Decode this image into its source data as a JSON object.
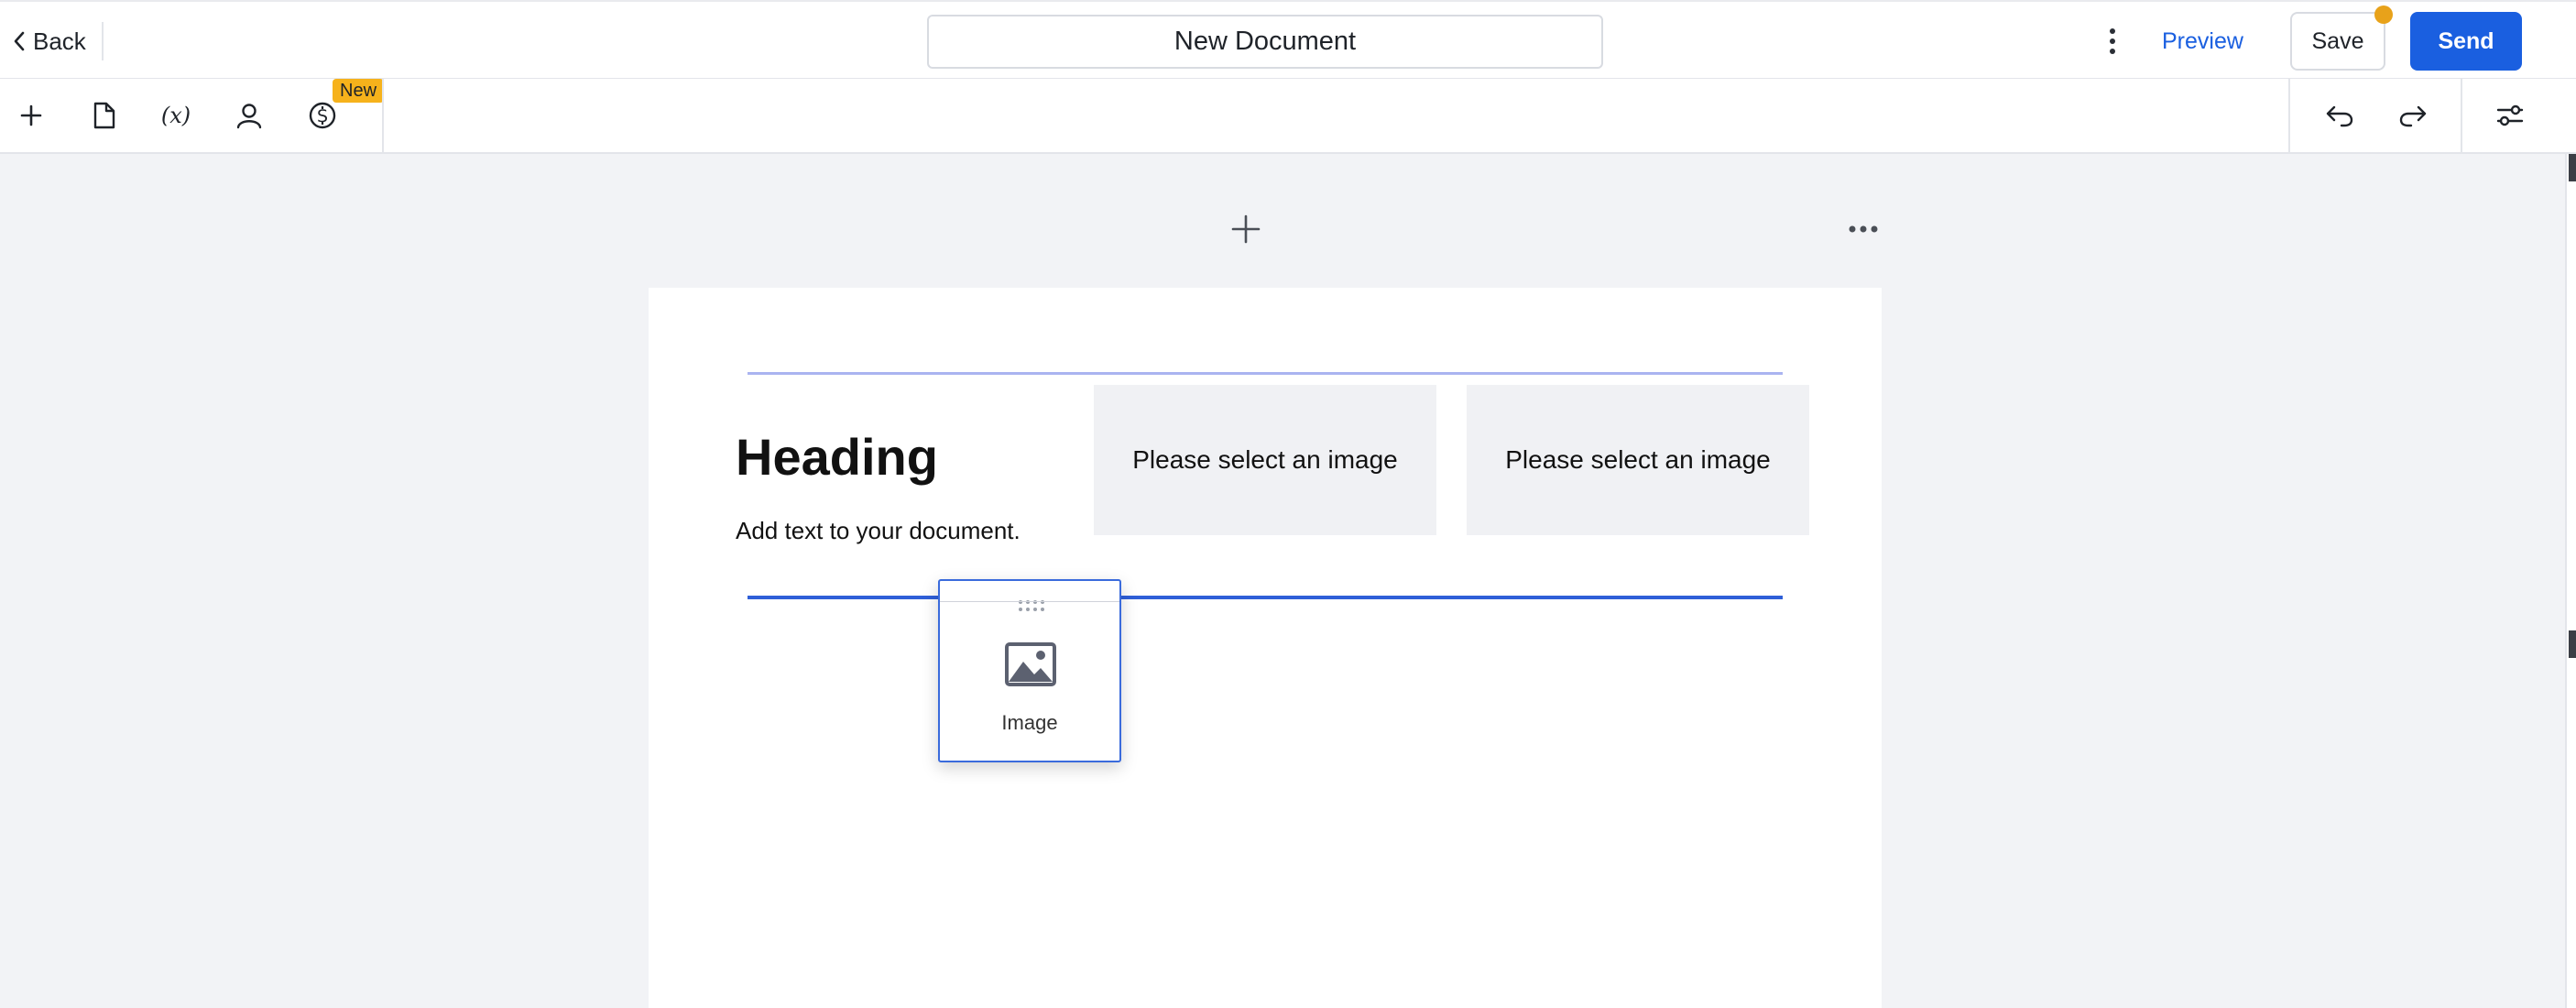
{
  "header": {
    "back_label": "Back",
    "document_title": "New Document",
    "preview_label": "Preview",
    "save_label": "Save",
    "send_label": "Send",
    "accent_color": "#1a5fe0",
    "unsaved_indicator_color": "#e8a21a"
  },
  "toolbar": {
    "tools": [
      "plus-icon",
      "document-icon",
      "variable-icon",
      "person-icon",
      "dollar-icon"
    ],
    "new_badge": "New",
    "right_tools": [
      "undo-icon",
      "redo-icon",
      "settings-sliders-icon"
    ]
  },
  "document": {
    "heading": "Heading",
    "body_text": "Add text to your document.",
    "image_placeholder_1": "Please select an image",
    "image_placeholder_2": "Please select an image"
  },
  "drag_block": {
    "label": "Image",
    "icon": "image-icon"
  }
}
